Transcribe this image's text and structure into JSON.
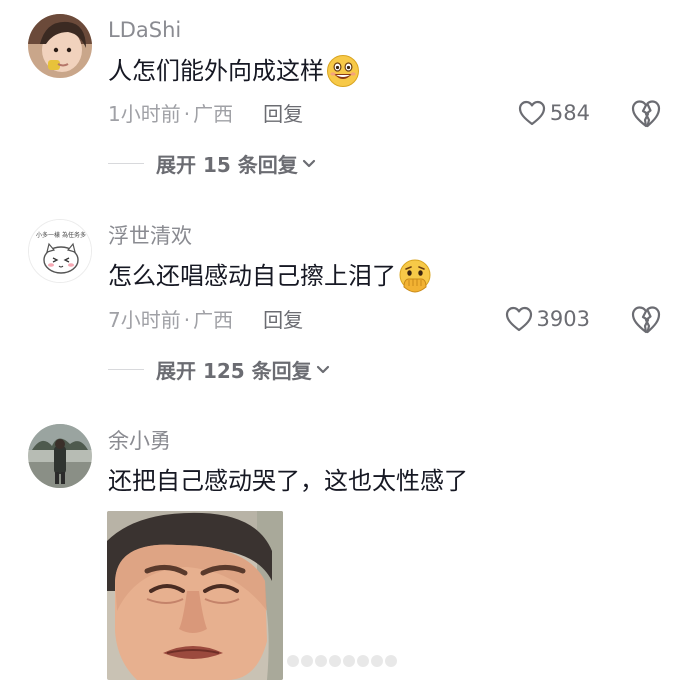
{
  "comments": [
    {
      "username": "LDaShi",
      "text": "人怎们能外向成这样",
      "emoji": "grinning-face-emoji",
      "time": "1小时前",
      "location": "广西",
      "reply_label": "回复",
      "likes": "584",
      "expand_label": "展开 15 条回复"
    },
    {
      "username": "浮世清欢",
      "text": "怎么还唱感动自己擦上泪了",
      "emoji": "hand-over-mouth-emoji",
      "time": "7小时前",
      "location": "广西",
      "reply_label": "回复",
      "likes": "3903",
      "expand_label": "展开 125 条回复"
    },
    {
      "username": "余小勇",
      "text": "还把自己感动哭了，这也太性感了",
      "image": "crying-man-photo"
    }
  ],
  "meta_separator": "·",
  "avatar_sticker_text": "小多一樣 為任务多",
  "colors": {
    "username": "#8a8b91",
    "body_text": "#161823",
    "meta": "#a0a1a6",
    "action": "#6b6c72"
  }
}
